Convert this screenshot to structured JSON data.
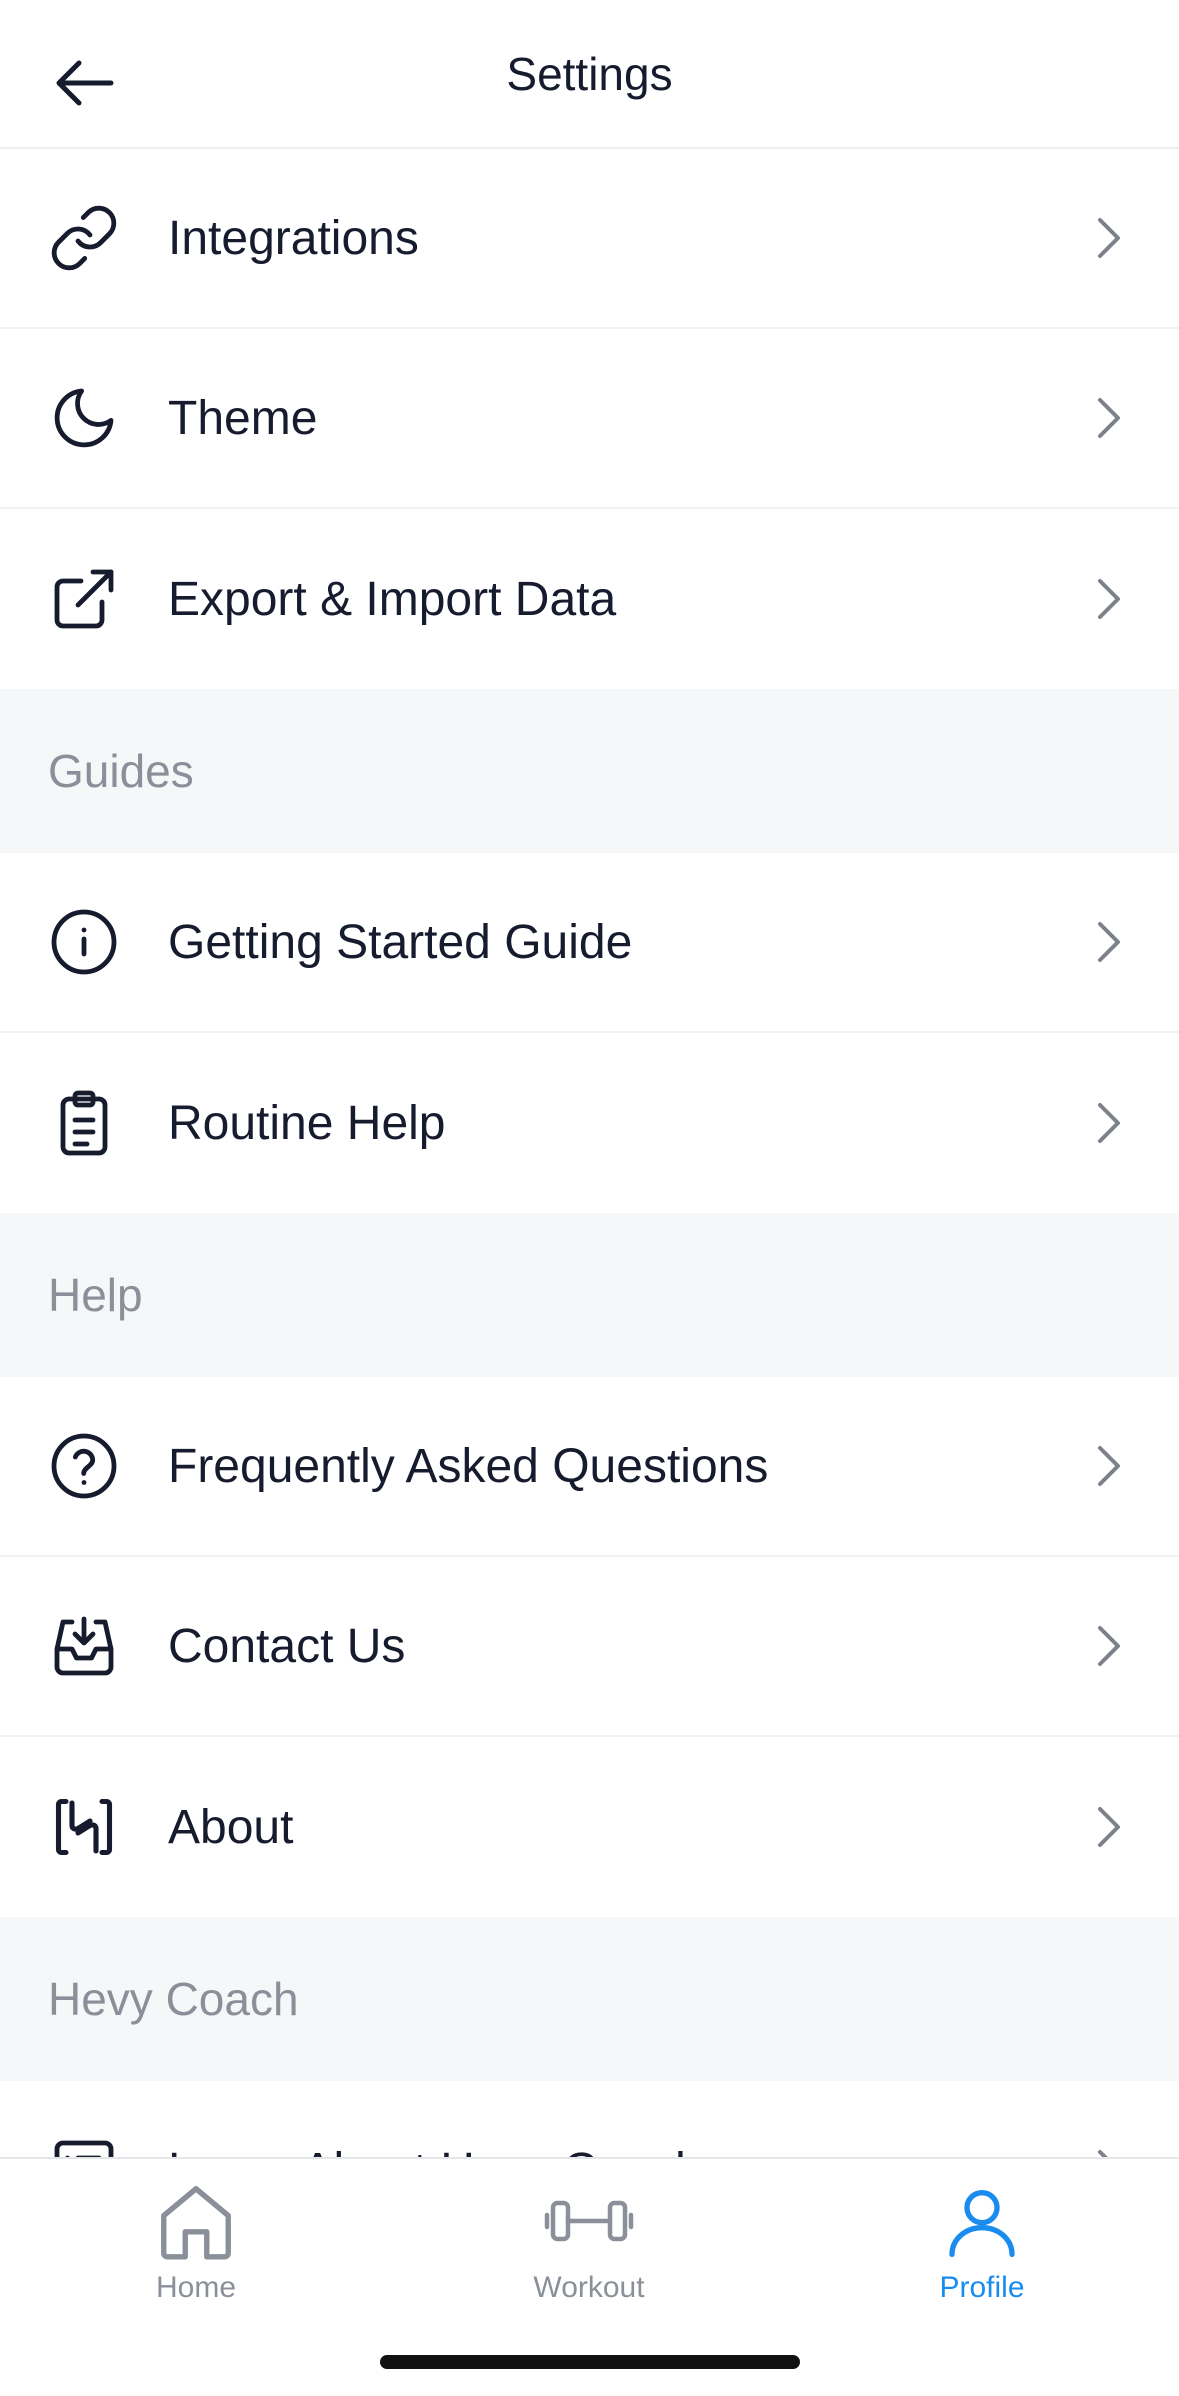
{
  "header": {
    "title": "Settings"
  },
  "groups": [
    {
      "items": [
        {
          "label": "Integrations"
        },
        {
          "label": "Theme"
        },
        {
          "label": "Export & Import Data"
        }
      ]
    },
    {
      "title": "Guides",
      "items": [
        {
          "label": "Getting Started Guide"
        },
        {
          "label": "Routine Help"
        }
      ]
    },
    {
      "title": "Help",
      "items": [
        {
          "label": "Frequently Asked Questions"
        },
        {
          "label": "Contact Us"
        },
        {
          "label": "About"
        }
      ]
    },
    {
      "title": "Hevy Coach",
      "items": [
        {
          "label": "Learn About Hevy Coach"
        }
      ]
    }
  ],
  "tabbar": {
    "tabs": [
      {
        "label": "Home",
        "icon": "home-icon"
      },
      {
        "label": "Workout",
        "icon": "dumbbell-icon"
      },
      {
        "label": "Profile",
        "icon": "profile-icon",
        "active": true
      }
    ]
  },
  "colors": {
    "text": "#161b2e",
    "secondary": "#8a8f99",
    "section_bg": "#f6f7f9",
    "accent": "#1a8cf0"
  }
}
